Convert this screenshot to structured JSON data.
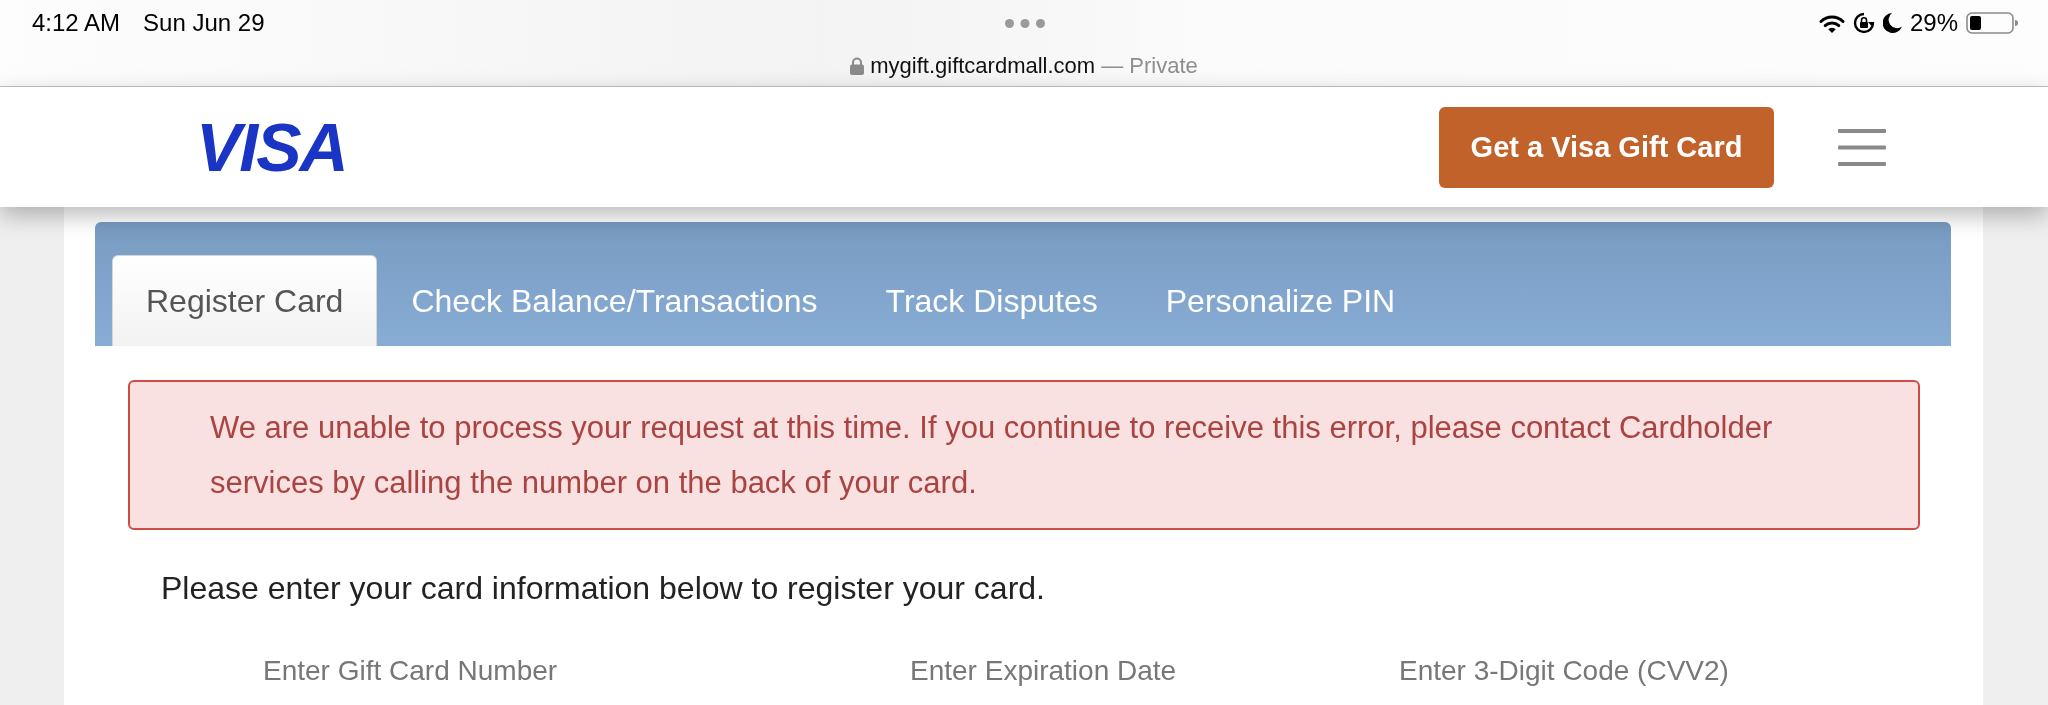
{
  "status_bar": {
    "time": "4:12 AM",
    "date": "Sun Jun 29",
    "battery": "29%"
  },
  "address_bar": {
    "domain": "mygift.giftcardmall.com",
    "mode": "— Private"
  },
  "header": {
    "logo": "VISA",
    "button": "Get a Visa Gift Card"
  },
  "tabs": [
    {
      "label": "Register Card",
      "selected": true
    },
    {
      "label": "Check Balance/Transactions",
      "selected": false
    },
    {
      "label": "Track Disputes",
      "selected": false
    },
    {
      "label": "Personalize PIN",
      "selected": false
    }
  ],
  "alert": {
    "message": "We are unable to process your request at this time. If you continue to receive this error, please contact Cardholder services by calling the number on the back of your card."
  },
  "intro": "Please enter your card information below to register your card.",
  "field_labels": [
    "Enter Gift Card Number",
    "Enter Expiration Date",
    "Enter 3-Digit Code (CVV2)"
  ]
}
